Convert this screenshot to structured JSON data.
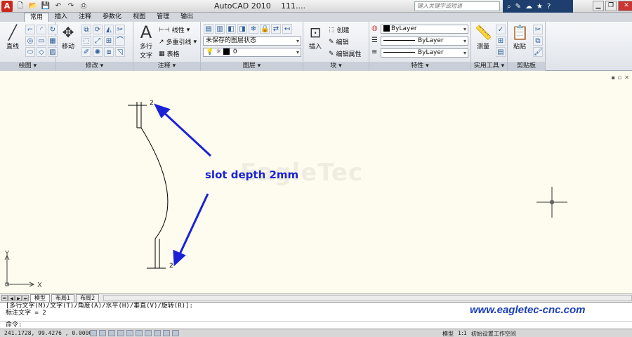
{
  "titlebar": {
    "app_name": "AutoCAD 2010",
    "doc_name": "111....",
    "search_placeholder": "键入关键字或短语"
  },
  "ribbon_tabs": [
    "常用",
    "插入",
    "注释",
    "参数化",
    "视图",
    "管理",
    "输出"
  ],
  "panels": {
    "draw": {
      "label": "绘图 ▾",
      "line_button": "直线"
    },
    "modify": {
      "label": "修改 ▾",
      "move_button": "移动"
    },
    "annotation": {
      "label": "注释 ▾",
      "mtext_button_l1": "多行",
      "mtext_button_l2": "文字",
      "linear": "线性",
      "multileader": "多重引线",
      "table": "表格"
    },
    "layers": {
      "label": "图层 ▾",
      "layer_state": "未保存的图层状态",
      "current_layer": "0"
    },
    "block": {
      "label": "块 ▾",
      "insert": "插入",
      "create": "创建",
      "edit": "编辑",
      "edit_attr": "编辑属性"
    },
    "properties": {
      "label": "特性 ▾",
      "color": "ByLayer",
      "linetype": "ByLayer",
      "lineweight": "ByLayer"
    },
    "utilities": {
      "label": "实用工具 ▾",
      "measure": "测量"
    },
    "clipboard": {
      "label": "剪贴板",
      "paste": "粘贴"
    }
  },
  "drawing": {
    "annotation_text": "slot depth 2mm",
    "dim_top": "2",
    "dim_bottom": "2",
    "watermark": "EagleTec",
    "ucs_x": "X",
    "ucs_y": "Y",
    "annotation_color": "#1b22d6"
  },
  "layout_tabs": [
    "模型",
    "布局1",
    "布局2"
  ],
  "command": {
    "line1": "[多行文字(M)/文字(T)/角度(A)/水平(H)/垂直(V)/旋转(R)]:",
    "line2": "标注文字 = 2",
    "prompt": "命令:"
  },
  "overlay_url": "www.eagletec-cnc.com",
  "statusbar": {
    "coords": "241.1728, 99.4276 , 0.0000",
    "model": "模型",
    "scale": "1:1",
    "workspace": "初始设置工作空间"
  }
}
